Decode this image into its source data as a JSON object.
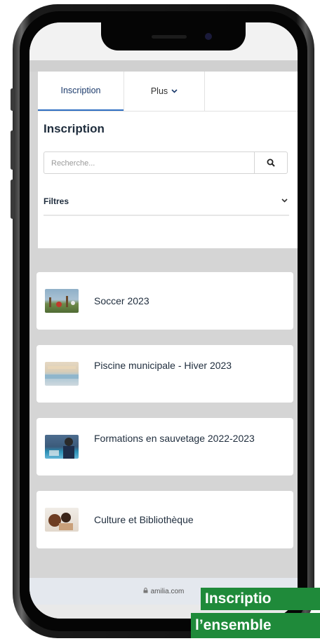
{
  "tabs": [
    {
      "label": "Inscription",
      "active": true
    },
    {
      "label": "Plus",
      "icon": "chevron-down-icon"
    }
  ],
  "page_title": "Inscription",
  "search": {
    "placeholder": "Recherche...",
    "value": "",
    "icon": "search-icon"
  },
  "filters": {
    "label": "Filtres",
    "icon": "chevron-down-icon"
  },
  "programs": [
    {
      "title": "Soccer 2023"
    },
    {
      "title": "Piscine municipale - Hiver 2023"
    },
    {
      "title": "Formations en sauvetage 2022-2023"
    },
    {
      "title": "Culture et Bibliothèque"
    }
  ],
  "footer": {
    "domain": "amilia.com",
    "icon": "lock-icon"
  },
  "caption": {
    "line1": "Inscriptio",
    "line2": "l’ensemble"
  },
  "colors": {
    "accent": "#2f6fc2",
    "caption_bg": "#1f8a3a",
    "page_bg": "#d5d5d5"
  }
}
